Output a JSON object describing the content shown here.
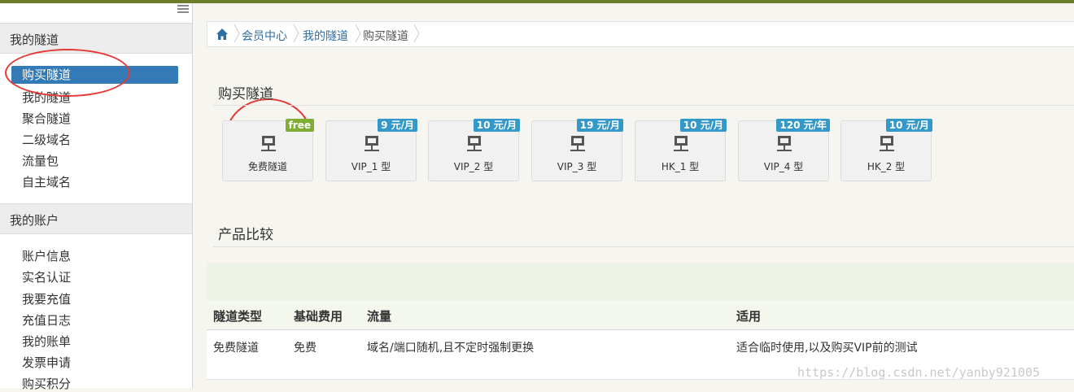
{
  "sidebar": {
    "section1_title": "我的隧道",
    "section1_items": [
      "购买隧道",
      "我的隧道",
      "聚合隧道",
      "二级域名",
      "流量包",
      "自主域名"
    ],
    "section2_title": "我的账户",
    "section2_items": [
      "账户信息",
      "实名认证",
      "我要充值",
      "充值日志",
      "我的账单",
      "发票申请",
      "购买积分"
    ]
  },
  "breadcrumb": [
    "会员中心",
    "我的隧道",
    "购买隧道"
  ],
  "purchase_title": "购买隧道",
  "tiles": [
    {
      "label": "免费隧道",
      "badge": "free"
    },
    {
      "label": "VIP_1 型",
      "badge": "9 元/月"
    },
    {
      "label": "VIP_2 型",
      "badge": "10 元/月"
    },
    {
      "label": "VIP_3 型",
      "badge": "19 元/月"
    },
    {
      "label": "HK_1 型",
      "badge": "10 元/月"
    },
    {
      "label": "VIP_4 型",
      "badge": "120 元/年"
    },
    {
      "label": "HK_2 型",
      "badge": "10 元/月"
    }
  ],
  "compare_title": "产品比较",
  "table": {
    "headers": [
      "隧道类型",
      "基础费用",
      "流量",
      "适用"
    ],
    "rows": [
      [
        "免费隧道",
        "免费",
        "域名/端口随机,且不定时强制更换",
        "适合临时使用,以及购买VIP前的测试"
      ]
    ]
  },
  "watermark": "https://blog.csdn.net/yanby921005",
  "colors": {
    "accent_blue": "#337ab7",
    "badge_blue": "#3498c8",
    "badge_green": "#82ad35",
    "annotation_red": "#e53935",
    "top_bar": "#6b7d2a"
  }
}
